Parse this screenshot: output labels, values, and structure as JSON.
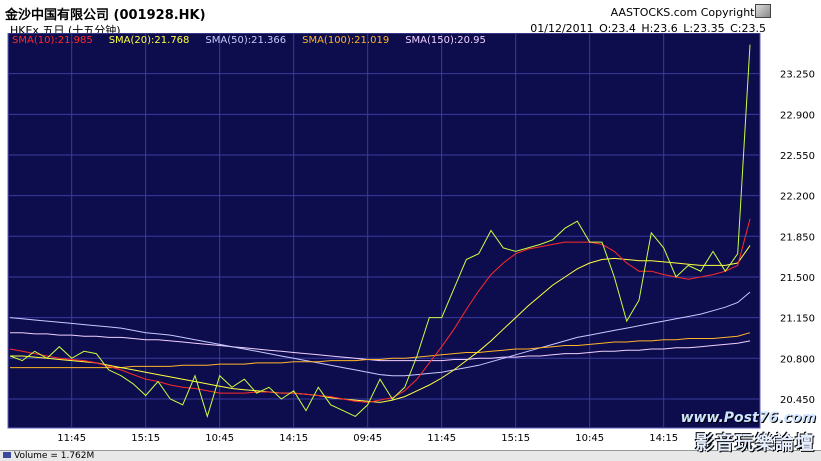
{
  "header": {
    "title": "金沙中国有限公司 (001928.HK)",
    "copyright": "AASTOCKS.com Copyright ©",
    "subtitle": "HKEx 五日 (十五分钟)",
    "quote": "01/12/2011  O:23.4  H:23.6  L:23.35  C:23.5"
  },
  "footer": {
    "volume_label": "Volume = 1.762M"
  },
  "watermark": {
    "line1": "www.Post76.com",
    "line2": "影音玩樂論壇"
  },
  "colors": {
    "background": "#0d0d4d",
    "grid": "#3a3aa0",
    "price": "#c8ff40",
    "sma10": "#ff2a2a",
    "sma20": "#ffff40",
    "sma50": "#c8c8ff",
    "sma100": "#ffb428",
    "sma150": "#f0d0ff"
  },
  "chart_data": {
    "type": "line",
    "ylim": [
      20.2,
      23.6
    ],
    "yticks": [
      20.45,
      20.8,
      21.15,
      21.5,
      21.85,
      22.2,
      22.55,
      22.9,
      23.25
    ],
    "ytick_labels": [
      "20.450",
      "20.800",
      "21.150",
      "21.500",
      "21.850",
      "22.200",
      "22.550",
      "22.900",
      "23.250"
    ],
    "xtick_labels": [
      "11:45",
      "15:15",
      "10:45",
      "14:15",
      "09:45",
      "11:45",
      "15:15",
      "10:45",
      "14:15"
    ],
    "xtick_index": [
      5,
      11,
      17,
      23,
      29,
      35,
      41,
      47,
      53
    ],
    "n_points": 61,
    "legend": [
      {
        "key": "sma10",
        "label": "SMA(10):21.985"
      },
      {
        "key": "sma20",
        "label": "SMA(20):21.768"
      },
      {
        "key": "sma50",
        "label": "SMA(50):21.366"
      },
      {
        "key": "sma100",
        "label": "SMA(100):21.019"
      },
      {
        "key": "sma150",
        "label": "SMA(150):20.95"
      }
    ],
    "series": [
      {
        "key": "price",
        "values": [
          20.82,
          20.78,
          20.86,
          20.8,
          20.9,
          20.8,
          20.86,
          20.84,
          20.7,
          20.65,
          20.58,
          20.48,
          20.6,
          20.45,
          20.4,
          20.65,
          20.3,
          20.65,
          20.55,
          20.62,
          20.5,
          20.55,
          20.45,
          20.52,
          20.35,
          20.55,
          20.4,
          20.35,
          20.3,
          20.4,
          20.62,
          20.45,
          20.55,
          20.82,
          21.15,
          21.15,
          21.4,
          21.65,
          21.7,
          21.9,
          21.75,
          21.72,
          21.75,
          21.78,
          21.82,
          21.92,
          21.98,
          21.8,
          21.8,
          21.5,
          21.12,
          21.3,
          21.88,
          21.75,
          21.5,
          21.6,
          21.55,
          21.72,
          21.55,
          21.7,
          23.5
        ]
      },
      {
        "key": "sma10",
        "values": [
          20.88,
          20.86,
          20.84,
          20.82,
          20.8,
          20.79,
          20.78,
          20.76,
          20.73,
          20.7,
          20.66,
          20.62,
          20.6,
          20.57,
          20.55,
          20.54,
          20.52,
          20.5,
          20.5,
          20.5,
          20.51,
          20.51,
          20.5,
          20.5,
          20.49,
          20.48,
          20.47,
          20.45,
          20.43,
          20.42,
          20.44,
          20.46,
          20.52,
          20.62,
          20.76,
          20.9,
          21.05,
          21.22,
          21.38,
          21.52,
          21.62,
          21.7,
          21.74,
          21.76,
          21.78,
          21.8,
          21.8,
          21.8,
          21.78,
          21.72,
          21.62,
          21.55,
          21.55,
          21.52,
          21.5,
          21.48,
          21.5,
          21.52,
          21.55,
          21.6,
          22.0
        ]
      },
      {
        "key": "sma20",
        "values": [
          20.82,
          20.82,
          20.81,
          20.8,
          20.79,
          20.78,
          20.77,
          20.76,
          20.74,
          20.72,
          20.7,
          20.68,
          20.66,
          20.64,
          20.62,
          20.6,
          20.58,
          20.56,
          20.54,
          20.53,
          20.52,
          20.51,
          20.5,
          20.5,
          20.49,
          20.48,
          20.46,
          20.45,
          20.44,
          20.43,
          20.42,
          20.44,
          20.47,
          20.52,
          20.57,
          20.63,
          20.7,
          20.78,
          20.86,
          20.95,
          21.05,
          21.15,
          21.25,
          21.34,
          21.43,
          21.5,
          21.57,
          21.62,
          21.65,
          21.66,
          21.65,
          21.64,
          21.64,
          21.63,
          21.62,
          21.61,
          21.6,
          21.6,
          21.6,
          21.62,
          21.77
        ]
      },
      {
        "key": "sma50",
        "values": [
          21.15,
          21.14,
          21.13,
          21.12,
          21.11,
          21.1,
          21.09,
          21.08,
          21.07,
          21.06,
          21.04,
          21.02,
          21.01,
          21.0,
          20.98,
          20.96,
          20.94,
          20.92,
          20.9,
          20.88,
          20.86,
          20.84,
          20.82,
          20.8,
          20.78,
          20.76,
          20.74,
          20.72,
          20.7,
          20.68,
          20.66,
          20.65,
          20.65,
          20.66,
          20.67,
          20.68,
          20.7,
          20.72,
          20.74,
          20.77,
          20.8,
          20.83,
          20.86,
          20.89,
          20.92,
          20.95,
          20.98,
          21.0,
          21.02,
          21.04,
          21.06,
          21.08,
          21.1,
          21.12,
          21.14,
          21.16,
          21.18,
          21.21,
          21.24,
          21.28,
          21.37
        ]
      },
      {
        "key": "sma100",
        "values": [
          20.72,
          20.72,
          20.72,
          20.72,
          20.72,
          20.72,
          20.72,
          20.72,
          20.72,
          20.72,
          20.73,
          20.73,
          20.73,
          20.73,
          20.74,
          20.74,
          20.74,
          20.75,
          20.75,
          20.75,
          20.76,
          20.76,
          20.76,
          20.77,
          20.77,
          20.77,
          20.78,
          20.78,
          20.78,
          20.79,
          20.79,
          20.8,
          20.8,
          20.81,
          20.82,
          20.83,
          20.84,
          20.85,
          20.85,
          20.86,
          20.87,
          20.88,
          20.88,
          20.89,
          20.9,
          20.91,
          20.91,
          20.92,
          20.93,
          20.94,
          20.94,
          20.95,
          20.95,
          20.96,
          20.96,
          20.97,
          20.97,
          20.97,
          20.98,
          20.99,
          21.02
        ]
      },
      {
        "key": "sma150",
        "values": [
          21.02,
          21.02,
          21.01,
          21.01,
          21.0,
          21.0,
          20.99,
          20.99,
          20.98,
          20.98,
          20.97,
          20.96,
          20.96,
          20.95,
          20.94,
          20.93,
          20.92,
          20.91,
          20.9,
          20.89,
          20.88,
          20.87,
          20.86,
          20.85,
          20.84,
          20.83,
          20.82,
          20.81,
          20.8,
          20.79,
          20.78,
          20.78,
          20.78,
          20.78,
          20.78,
          20.78,
          20.79,
          20.79,
          20.8,
          20.8,
          20.81,
          20.81,
          20.82,
          20.82,
          20.83,
          20.84,
          20.84,
          20.85,
          20.86,
          20.86,
          20.87,
          20.87,
          20.88,
          20.88,
          20.89,
          20.89,
          20.9,
          20.91,
          20.92,
          20.93,
          20.95
        ]
      }
    ]
  }
}
